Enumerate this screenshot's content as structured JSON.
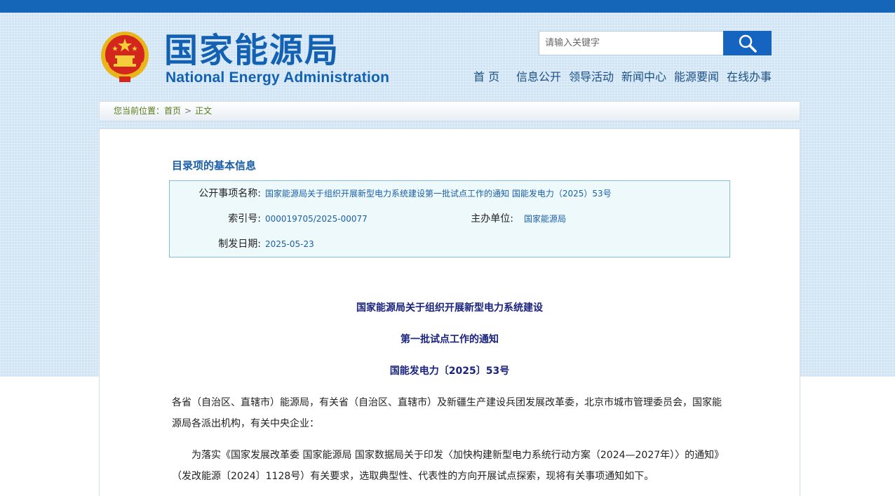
{
  "header": {
    "logo_cn": "国家能源局",
    "logo_en": "National Energy Administration",
    "emblem_icon": "national-emblem-icon",
    "search": {
      "placeholder": "请输入关键字",
      "icon": "search-icon"
    },
    "nav": [
      {
        "label": "首 页"
      },
      {
        "label": "信息公开"
      },
      {
        "label": "领导活动"
      },
      {
        "label": "新闻中心"
      },
      {
        "label": "能源要闻"
      },
      {
        "label": "在线办事"
      }
    ]
  },
  "breadcrumb": {
    "prefix": "您当前位置：",
    "home": "首页",
    "separator": ">",
    "current": "正文"
  },
  "catalog": {
    "title": "目录项的基本信息",
    "rows": {
      "name_label": "公开事项名称:",
      "name_value": "国家能源局关于组织开展新型电力系统建设第一批试点工作的通知 国能发电力（2025）53号",
      "index_label": "索引号:",
      "index_value": "000019705/2025-00077",
      "org_label": "主办单位:",
      "org_value": "国家能源局",
      "date_label": "制发日期:",
      "date_value": "2025-05-23"
    }
  },
  "document": {
    "title_line1": "国家能源局关于组织开展新型电力系统建设",
    "title_line2": "第一批试点工作的通知",
    "doc_number": "国能发电力〔2025〕53号",
    "salutation": "各省（自治区、直辖市）能源局，有关省（自治区、直辖市）及新疆生产建设兵团发展改革委，北京市城市管理委员会，国家能源局各派出机构，有关中央企业：",
    "para1": "为落实《国家发展改革委 国家能源局 国家数据局关于印发〈加快构建新型电力系统行动方案（2024—2027年）〉的通知》（发改能源〔2024〕1128号）有关要求，选取典型性、代表性的方向开展试点探索，现将有关事项通知如下。"
  },
  "colors": {
    "brand_blue": "#1361b3",
    "top_bar": "#1565b8",
    "doc_title": "#1a237e"
  }
}
